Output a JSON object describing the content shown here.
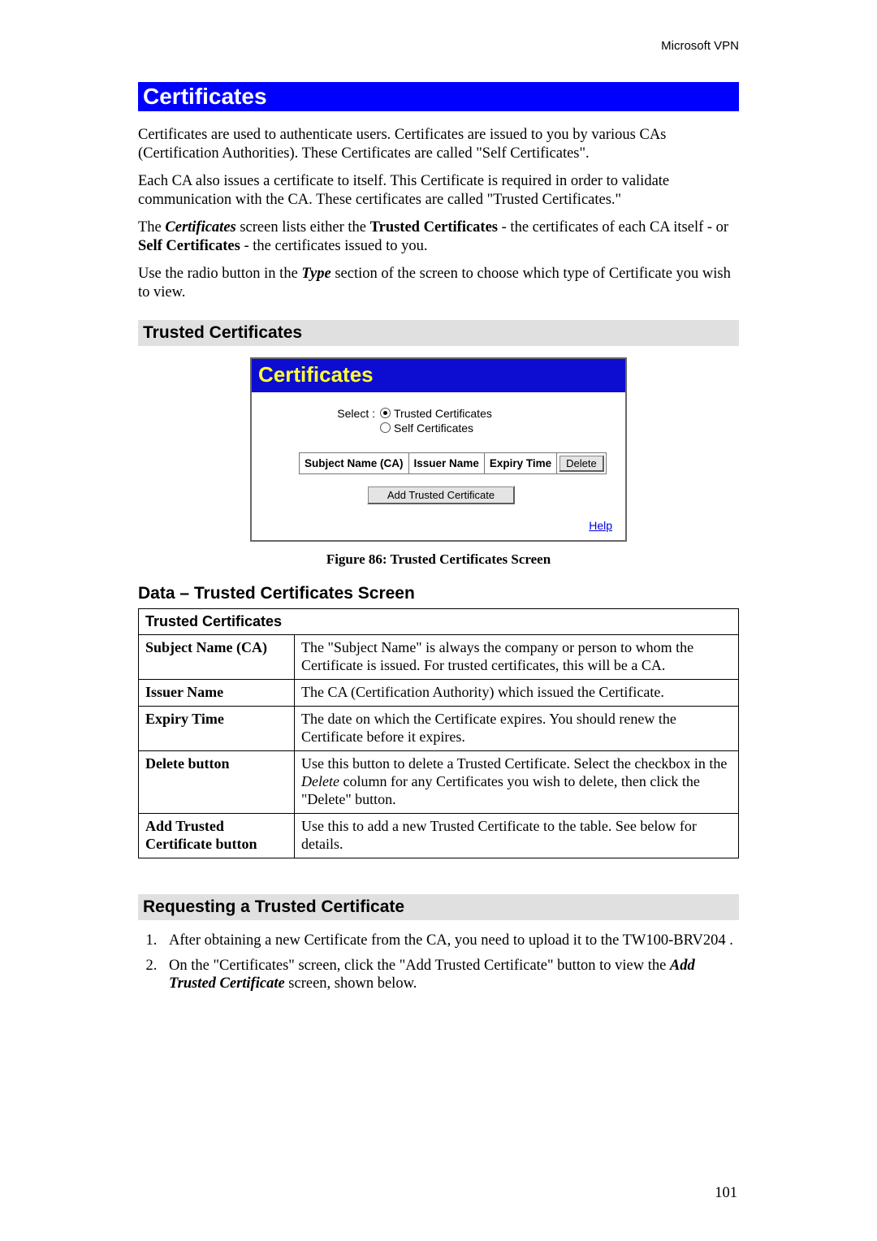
{
  "header_right": "Microsoft VPN",
  "h1": "Certificates",
  "intro": [
    "Certificates are used to authenticate users. Certificates are issued to you by various CAs (Certification Authorities). These Certificates are called \"Self Certificates\".",
    "Each CA also issues a certificate to itself. This Certificate is required in order to validate communication with the CA. These certificates are called \"Trusted Certificates.\""
  ],
  "certs_line": {
    "pre": "The ",
    "bi1": "Certificates",
    "mid1": " screen lists either the ",
    "b1": "Trusted Certificates",
    "mid2": " - the certificates of each CA itself - or ",
    "b2": "Self Certificates",
    "tail": " - the certificates issued to you."
  },
  "radio_line": {
    "pre": "Use the radio button in the ",
    "bi": "Type",
    "tail": " section of the screen to choose which type of Certificate you wish to view."
  },
  "h2_trusted": "Trusted Certificates",
  "shot": {
    "title": "Certificates",
    "select_label": "Select :",
    "opt_trusted": "Trusted Certificates",
    "opt_self": "Self Certificates",
    "cols": {
      "subject": "Subject Name (CA)",
      "issuer": "Issuer Name",
      "expiry": "Expiry Time"
    },
    "delete_btn": "Delete",
    "add_btn": "Add Trusted Certificate",
    "help": "Help"
  },
  "fig_caption": "Figure 86: Trusted Certificates Screen",
  "h2_data": "Data – Trusted Certificates Screen",
  "table": {
    "header_row": "Trusted Certificates",
    "rows": [
      {
        "label": "Subject Name (CA)",
        "desc_pre": "The \"Subject Name\" is always the company or person to whom the Certificate is issued. For trusted certificates, this will be a CA.",
        "desc_i": "",
        "desc_post": ""
      },
      {
        "label": "Issuer Name",
        "desc_pre": "The CA (Certification Authority) which issued the Certificate.",
        "desc_i": "",
        "desc_post": ""
      },
      {
        "label": "Expiry Time",
        "desc_pre": "The date on which the Certificate expires. You should renew the Certificate before it expires.",
        "desc_i": "",
        "desc_post": ""
      },
      {
        "label": "Delete button",
        "desc_pre": "Use this button to delete a Trusted Certificate. Select the checkbox in the ",
        "desc_i": "Delete",
        "desc_post": " column for any Certificates you wish to delete, then click the \"Delete\" button."
      },
      {
        "label": "Add Trusted Certificate button",
        "desc_pre": "Use this to add a new Trusted Certificate to the table. See below for details.",
        "desc_i": "",
        "desc_post": ""
      }
    ]
  },
  "h2_request": "Requesting a Trusted Certificate",
  "steps": {
    "s1": "After obtaining a new Certificate from the CA, you need to upload it to the TW100-BRV204 .",
    "s2_pre": "On the \"Certificates\" screen, click the \"Add Trusted Certificate\" button to view the ",
    "s2_bi": "Add Trusted Certificate",
    "s2_post": " screen, shown below."
  },
  "page_number": "101"
}
